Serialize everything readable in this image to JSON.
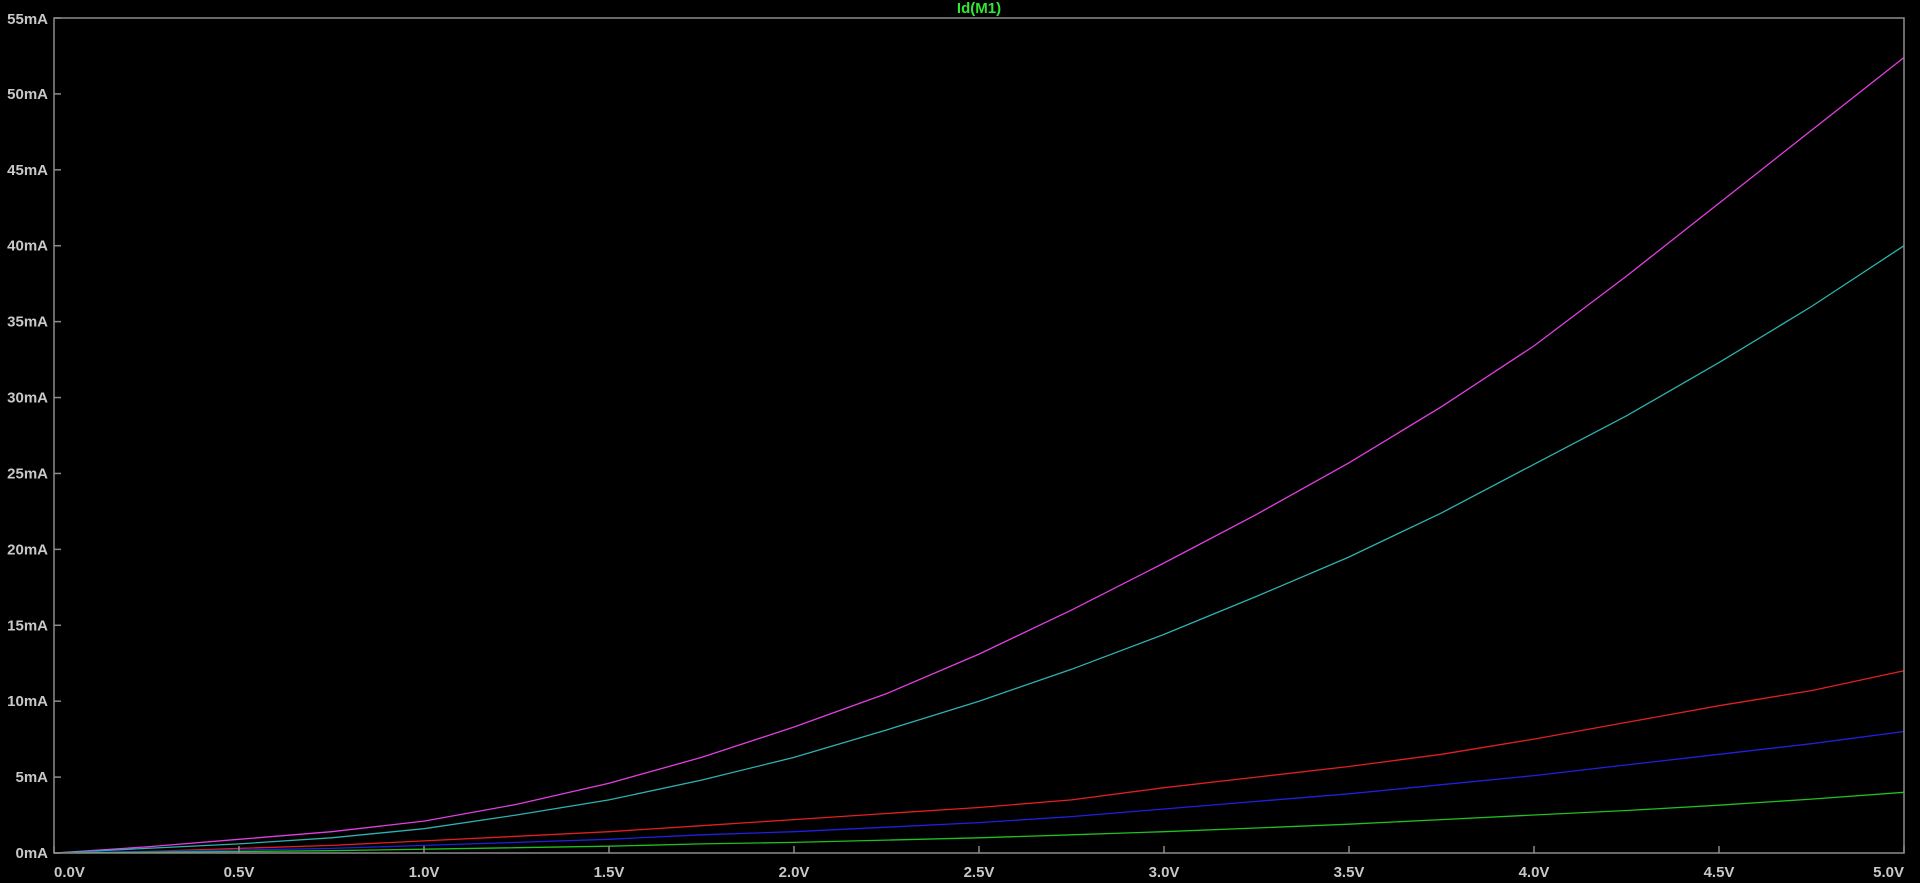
{
  "chart_data": {
    "type": "line",
    "title": "",
    "xlabel": "",
    "ylabel": "",
    "xlim": [
      0,
      5
    ],
    "ylim": [
      0,
      55
    ],
    "x_ticks": [
      "0.0V",
      "0.5V",
      "1.0V",
      "1.5V",
      "2.0V",
      "2.5V",
      "3.0V",
      "3.5V",
      "4.0V",
      "4.5V",
      "5.0V"
    ],
    "y_ticks": [
      "0mA",
      "5mA",
      "10mA",
      "15mA",
      "20mA",
      "25mA",
      "30mA",
      "35mA",
      "40mA",
      "45mA",
      "50mA",
      "55mA"
    ],
    "x_unit": "V",
    "y_unit": "mA",
    "grid": false,
    "background": "#000000",
    "axis_color": "#8c8c8c",
    "tick_label_color": "#c8c8c8",
    "trace_labels": [
      {
        "text": "Id(M1)",
        "color": "#33e633"
      }
    ],
    "x": [
      0,
      0.25,
      0.5,
      0.75,
      1.0,
      1.25,
      1.5,
      1.75,
      2.0,
      2.25,
      2.5,
      2.75,
      3.0,
      3.25,
      3.5,
      3.75,
      4.0,
      4.25,
      4.5,
      4.75,
      5.0
    ],
    "series": [
      {
        "color": "#e040e0",
        "values": [
          0,
          0.4,
          0.9,
          1.4,
          2.1,
          3.2,
          4.6,
          6.3,
          8.3,
          10.5,
          13.1,
          16.0,
          19.1,
          22.3,
          25.7,
          29.4,
          33.4,
          38.0,
          42.8,
          47.6,
          52.4
        ]
      },
      {
        "color": "#30b0b0",
        "values": [
          0,
          0.3,
          0.6,
          1.0,
          1.6,
          2.5,
          3.5,
          4.8,
          6.3,
          8.1,
          10.0,
          12.1,
          14.4,
          16.9,
          19.5,
          22.4,
          25.6,
          28.8,
          32.3,
          36.0,
          40.0
        ]
      },
      {
        "color": "#e02020",
        "values": [
          0,
          0.1,
          0.3,
          0.5,
          0.8,
          1.1,
          1.4,
          1.8,
          2.2,
          2.6,
          3.0,
          3.5,
          4.3,
          5.0,
          5.7,
          6.5,
          7.5,
          8.6,
          9.7,
          10.7,
          12.0
        ]
      },
      {
        "color": "#2020e0",
        "values": [
          0,
          0.1,
          0.2,
          0.3,
          0.5,
          0.7,
          0.9,
          1.2,
          1.4,
          1.7,
          2.0,
          2.4,
          2.9,
          3.4,
          3.9,
          4.5,
          5.1,
          5.8,
          6.5,
          7.2,
          8.0
        ]
      },
      {
        "color": "#20c020",
        "values": [
          0,
          0.05,
          0.1,
          0.15,
          0.25,
          0.35,
          0.45,
          0.6,
          0.7,
          0.85,
          1.0,
          1.2,
          1.4,
          1.65,
          1.9,
          2.2,
          2.5,
          2.8,
          3.15,
          3.55,
          4.0
        ]
      }
    ]
  }
}
